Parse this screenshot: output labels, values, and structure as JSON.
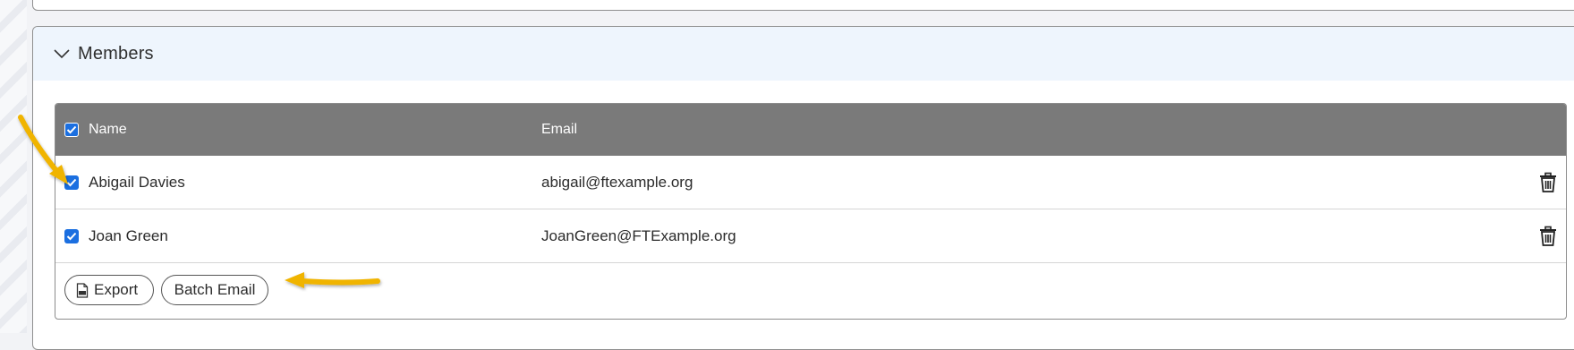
{
  "members_panel": {
    "title": "Members"
  },
  "table": {
    "columns": [
      "Name",
      "Email"
    ],
    "rows": [
      {
        "name": "Abigail Davies",
        "email": "abigail@ftexample.org",
        "checked": true
      },
      {
        "name": "Joan Green",
        "email": "JoanGreen@FTExample.org",
        "checked": true
      }
    ]
  },
  "actions": {
    "export_label": "Export",
    "batch_email_label": "Batch Email"
  },
  "icons": {
    "collapse": "chevron-down-icon",
    "delete": "trash-icon",
    "export": "csv-file-icon",
    "checkbox": "check-icon",
    "annotation": "arrow-icon"
  },
  "colors": {
    "header_bg": "#7a7a7a",
    "panel_header_bg": "#eef5fd",
    "checkbox": "#1b6fe0",
    "arrow": "#f0b400"
  }
}
